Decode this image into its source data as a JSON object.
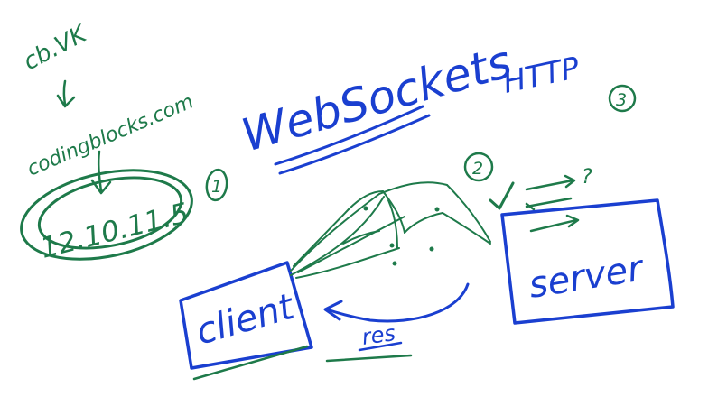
{
  "colors": {
    "green": "#1e7a4a",
    "blue": "#1a3fd0",
    "background": "#ffffff"
  },
  "notes": {
    "domain_in": "cb.VK",
    "domain_out": "codingblocks.com",
    "ip_address": "12.10.11.5",
    "step_1": "1",
    "step_2": "2",
    "step_3": "3",
    "question": "?"
  },
  "titles": {
    "main": "WebSockets",
    "protocol": "HTTP"
  },
  "boxes": {
    "client": "client",
    "server": "server"
  },
  "labels": {
    "response": "res"
  }
}
